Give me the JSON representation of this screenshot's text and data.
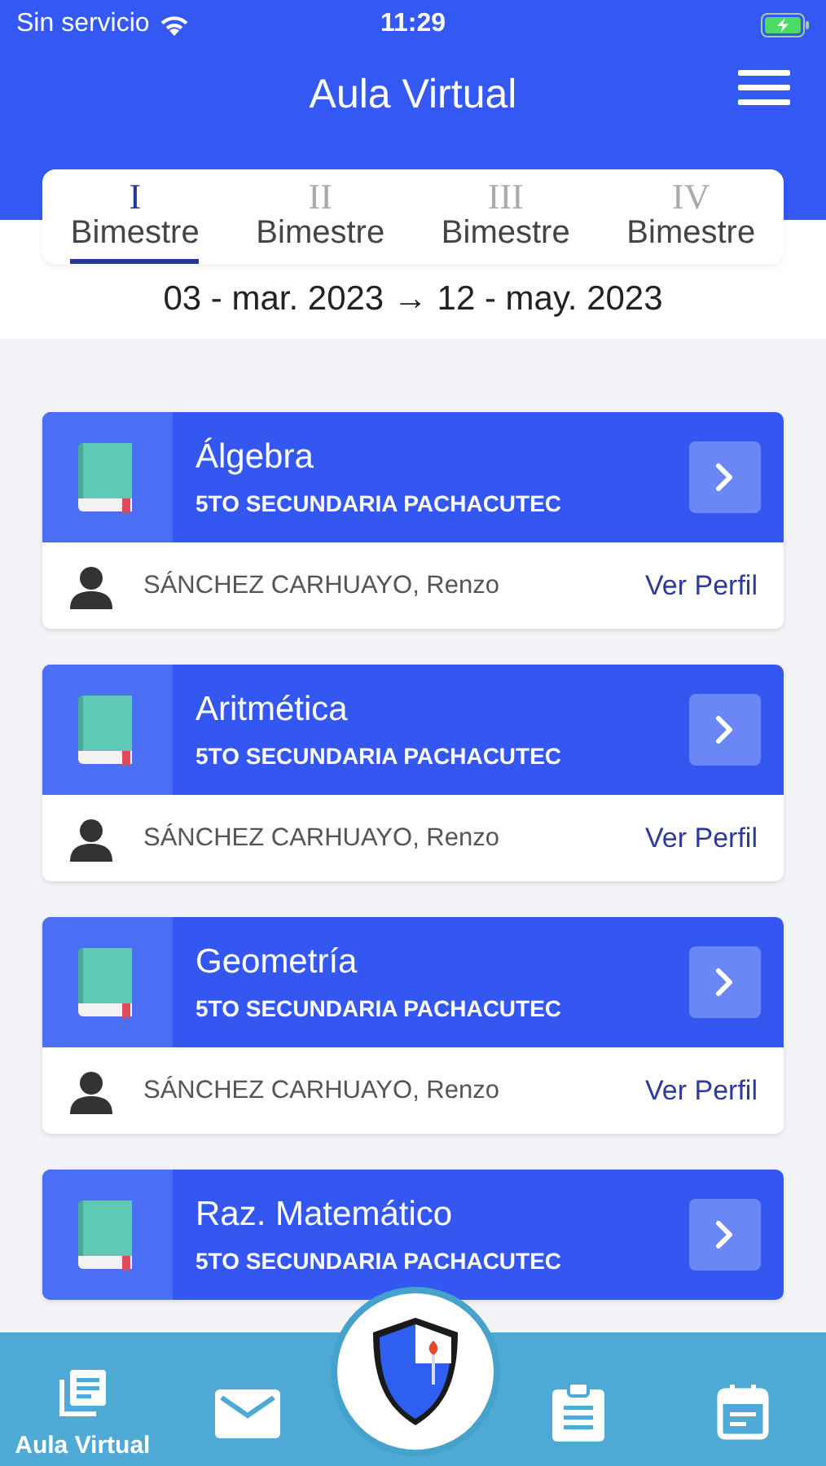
{
  "status_bar": {
    "carrier": "Sin servicio",
    "time": "11:29"
  },
  "header": {
    "title": "Aula Virtual"
  },
  "tabs": [
    {
      "numeral": "I",
      "label": "Bimestre",
      "selected": true
    },
    {
      "numeral": "II",
      "label": "Bimestre",
      "selected": false
    },
    {
      "numeral": "III",
      "label": "Bimestre",
      "selected": false
    },
    {
      "numeral": "IV",
      "label": "Bimestre",
      "selected": false
    }
  ],
  "date_range": "03 - mar. 2023 → 12 - may. 2023",
  "courses": [
    {
      "name": "Álgebra",
      "group": "5TO SECUNDARIA PACHACUTEC",
      "teacher": "SÁNCHEZ CARHUAYO, Renzo",
      "link": "Ver Perfil"
    },
    {
      "name": "Aritmética",
      "group": "5TO SECUNDARIA PACHACUTEC",
      "teacher": "SÁNCHEZ CARHUAYO, Renzo",
      "link": "Ver Perfil"
    },
    {
      "name": "Geometría",
      "group": "5TO SECUNDARIA PACHACUTEC",
      "teacher": "SÁNCHEZ CARHUAYO, Renzo",
      "link": "Ver Perfil"
    },
    {
      "name": "Raz. Matemático",
      "group": "5TO SECUNDARIA PACHACUTEC"
    }
  ],
  "bottom_nav": [
    {
      "kind": "documents",
      "label": "Aula Virtual"
    },
    {
      "kind": "mail"
    },
    {
      "kind": "emblem"
    },
    {
      "kind": "clipboard"
    },
    {
      "kind": "calendar"
    }
  ]
}
